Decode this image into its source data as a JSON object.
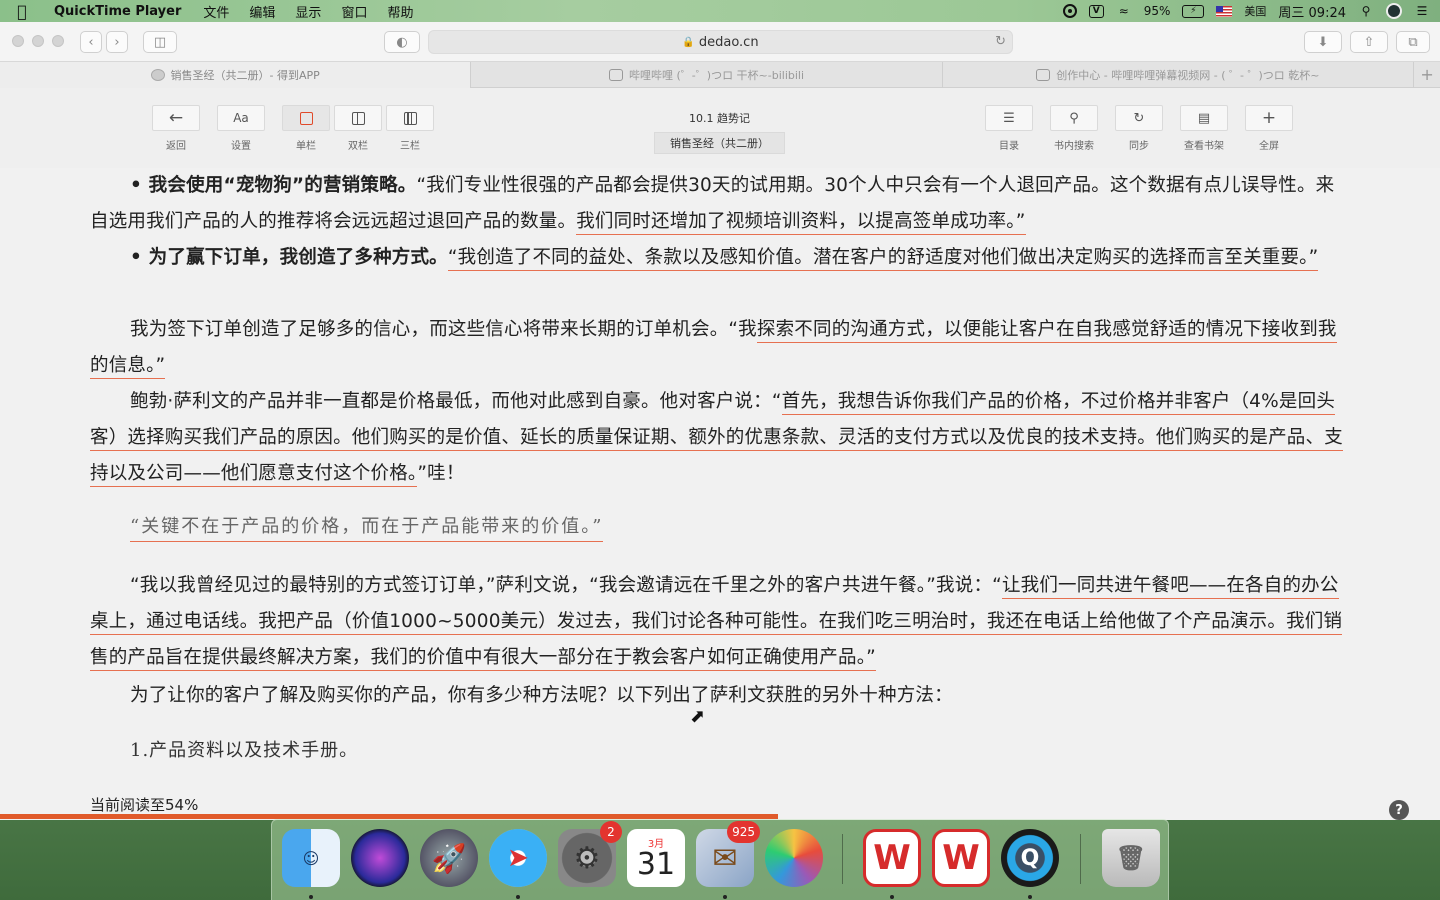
{
  "menubar": {
    "app_name": "QuickTime Player",
    "items": [
      "文件",
      "编辑",
      "显示",
      "窗口",
      "帮助"
    ],
    "battery": "95%",
    "input_method": "美国",
    "clock": "周三 09:24"
  },
  "browser": {
    "url": "dedao.cn",
    "tabs": [
      {
        "title": "销售圣经（共二册）- 得到APP",
        "active": true
      },
      {
        "title": "哔哩哔哩 (゜-゜)つロ 干杯~-bilibili",
        "active": false
      },
      {
        "title": "创作中心 - 哔哩哔哩弹幕视频网 - ( ゜- ゜)つロ 乾杯~",
        "active": false
      }
    ]
  },
  "reader": {
    "back_label": "返回",
    "settings_icon": "Aa",
    "settings_label": "设置",
    "single_label": "单栏",
    "double_label": "双栏",
    "triple_label": "三栏",
    "chapter": "10.1 趋势记",
    "book_title": "销售圣经（共二册）",
    "toc_label": "目录",
    "search_label": "书内搜索",
    "sync_label": "同步",
    "shelf_label": "查看书架",
    "fullscreen_label": "全屏"
  },
  "content": {
    "p1_bold": "• 我会使用“宠物狗”的营销策略。",
    "p1_a": "“我们专业性很强的产品都会提供30天的试用期。30个人中只会有一个人退回产品。这个数据有点儿误导性。来自选用我们产品的人的推荐将会远远超过退回产品的数量。",
    "p1_u": "我们同时还增加了视频培训资料，以提高签单成功率。”",
    "p2_bold": "• 为了赢下订单，我创造了多种方式。",
    "p2_u": "“我创造了不同的益处、条款以及感知价值。潜在客户的舒适度对他们做出决定购买的选择而言至关重要。”",
    "p3_a": "我为签下订单创造了足够多的信心，而这些信心将带来长期的订单机会。“我",
    "p3_u": "探索不同的沟通方式，以便能让客户在自我感觉舒适的情况下接收到我的信息。”",
    "p4_a": "鲍勃·萨利文的产品并非一直都是价格最低，而他对此感到自豪。他对客户说：“",
    "p4_u": "首先，我想告诉你我们产品的价格，不过价格并非客户（4%是回头客）选择购买我们产品的原因。他们购买的是价值、延长的质量保证期、额外的优惠条款、灵活的支付方式以及优良的技术支持。他们购买的是产品、支持以及公司——他们愿意支付这个价格。",
    "p4_b": "”哇！",
    "quote": "“关键不在于产品的价格，而在于产品能带来的价值。”",
    "p5_a": "“我以我曾经见过的最特别的方式签订订单，”萨利文说，“我会邀请远在千里之外的客户共进午餐。”我说：“",
    "p5_u": "让我们一同共进午餐吧——在各自的办公桌上，通过电话线。我把产品（价值1000~5000美元）发过去，我们讨论各种可能性。在我们吃三明治时，我还在电话上给他做了个产品演示。我们销售的产品旨在提供最终解决方案，我们的价值中有很大一部分在于教会客户如何正确使用产品。”",
    "p6": "为了让你的客户了解及购买你的产品，你有多少种方法呢？以下列出了萨利文获胜的另外十种方法：",
    "item1": "1.产品资料以及技术手册。",
    "progress_text": "当前阅读至54%",
    "progress_fraction": 0.54,
    "help_icon": "?"
  },
  "dock": {
    "calendar_month": "3月",
    "calendar_day": "31",
    "settings_badge": "2",
    "mail_badge": "925",
    "wps_label": "W"
  }
}
